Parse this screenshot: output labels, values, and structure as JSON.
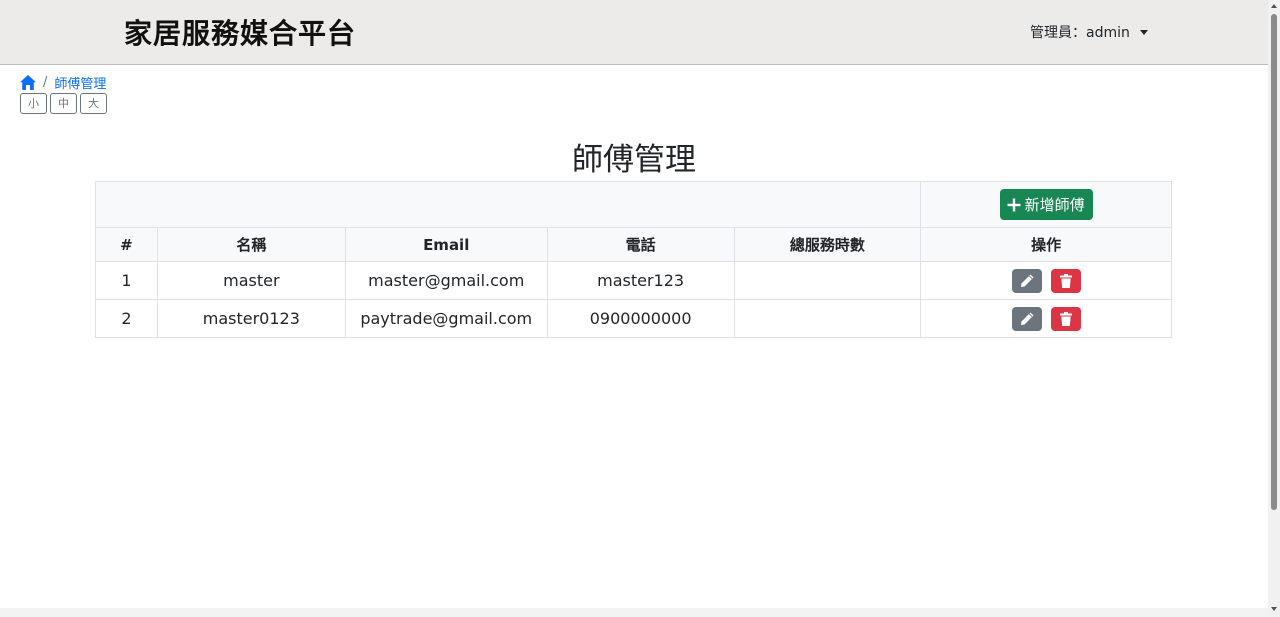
{
  "header": {
    "brand": "家居服務媒合平台",
    "user_menu_label": "管理員：admin"
  },
  "breadcrumb": {
    "home_icon": "home-icon",
    "separator": "/",
    "current": "師傅管理"
  },
  "font_size_buttons": [
    "小",
    "中",
    "大"
  ],
  "page_title": "師傅管理",
  "table": {
    "add_button_label": "新增師傅",
    "columns": [
      "#",
      "名稱",
      "Email",
      "電話",
      "總服務時數",
      "操作"
    ],
    "rows": [
      {
        "index": "1",
        "name": "master",
        "email": "master@gmail.com",
        "phone": "master123",
        "hours": ""
      },
      {
        "index": "2",
        "name": "master0123",
        "email": "paytrade@gmail.com",
        "phone": "0900000000",
        "hours": ""
      }
    ]
  },
  "colors": {
    "navbar_bg": "#edebe9",
    "link": "#0d6efd",
    "success": "#198754",
    "secondary": "#6c757d",
    "danger": "#dc3545"
  }
}
